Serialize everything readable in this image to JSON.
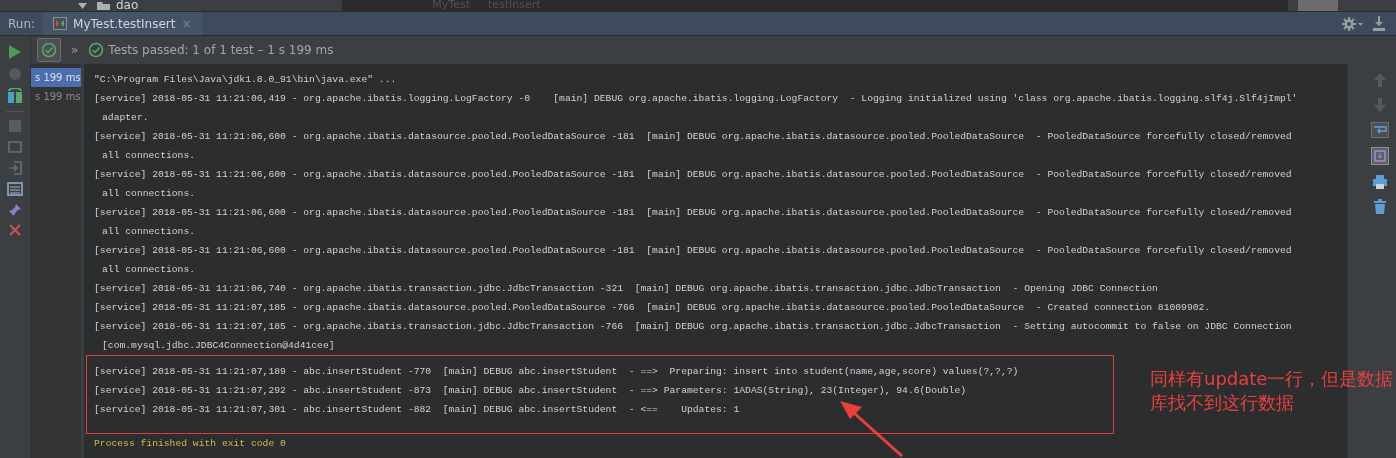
{
  "project_tree": {
    "folder": "dao",
    "breadcrumb": [
      "MyTest",
      "testInsert"
    ]
  },
  "run_bar": {
    "label": "Run:",
    "tab": {
      "title": "MyTest.testInsert",
      "close": "×"
    }
  },
  "test_toolbar": {
    "more": "»",
    "status": "Tests passed: 1 of 1 test – 1 s 199 ms"
  },
  "test_tree": [
    {
      "time": "s 199 ms",
      "selected": true
    },
    {
      "time": "s 199 ms",
      "selected": false
    }
  ],
  "console": [
    {
      "kind": "cmd",
      "text": "\"C:\\Program Files\\Java\\jdk1.8.0_91\\bin\\java.exe\" ..."
    },
    {
      "kind": "log",
      "text": "[service] 2018-05-31 11:21:06,419 - org.apache.ibatis.logging.LogFactory -0    [main] DEBUG org.apache.ibatis.logging.LogFactory  - Logging initialized using 'class org.apache.ibatis.logging.slf4j.Slf4jImpl'"
    },
    {
      "kind": "wrap",
      "text": "adapter."
    },
    {
      "kind": "log",
      "text": "[service] 2018-05-31 11:21:06,600 - org.apache.ibatis.datasource.pooled.PooledDataSource -181  [main] DEBUG org.apache.ibatis.datasource.pooled.PooledDataSource  - PooledDataSource forcefully closed/removed"
    },
    {
      "kind": "wrap",
      "text": "all connections."
    },
    {
      "kind": "log",
      "text": "[service] 2018-05-31 11:21:06,600 - org.apache.ibatis.datasource.pooled.PooledDataSource -181  [main] DEBUG org.apache.ibatis.datasource.pooled.PooledDataSource  - PooledDataSource forcefully closed/removed"
    },
    {
      "kind": "wrap",
      "text": "all connections."
    },
    {
      "kind": "log",
      "text": "[service] 2018-05-31 11:21:06,600 - org.apache.ibatis.datasource.pooled.PooledDataSource -181  [main] DEBUG org.apache.ibatis.datasource.pooled.PooledDataSource  - PooledDataSource forcefully closed/removed"
    },
    {
      "kind": "wrap",
      "text": "all connections."
    },
    {
      "kind": "log",
      "text": "[service] 2018-05-31 11:21:06,600 - org.apache.ibatis.datasource.pooled.PooledDataSource -181  [main] DEBUG org.apache.ibatis.datasource.pooled.PooledDataSource  - PooledDataSource forcefully closed/removed"
    },
    {
      "kind": "wrap",
      "text": "all connections."
    },
    {
      "kind": "log",
      "text": "[service] 2018-05-31 11:21:06,740 - org.apache.ibatis.transaction.jdbc.JdbcTransaction -321  [main] DEBUG org.apache.ibatis.transaction.jdbc.JdbcTransaction  - Opening JDBC Connection"
    },
    {
      "kind": "log",
      "text": "[service] 2018-05-31 11:21:07,185 - org.apache.ibatis.datasource.pooled.PooledDataSource -766  [main] DEBUG org.apache.ibatis.datasource.pooled.PooledDataSource  - Created connection 81009902."
    },
    {
      "kind": "log",
      "text": "[service] 2018-05-31 11:21:07,185 - org.apache.ibatis.transaction.jdbc.JdbcTransaction -766  [main] DEBUG org.apache.ibatis.transaction.jdbc.JdbcTransaction  - Setting autocommit to false on JDBC Connection"
    },
    {
      "kind": "wrap",
      "text": "[com.mysql.jdbc.JDBC4Connection@4d41cee]"
    }
  ],
  "highlighted_lines": [
    {
      "text": "[service] 2018-05-31 11:21:07,189 - abc.insertStudent -770  [main] DEBUG abc.insertStudent  - ==>  Preparing: insert into student(name,age,score) values(?,?,?)"
    },
    {
      "text": "[service] 2018-05-31 11:21:07,292 - abc.insertStudent -873  [main] DEBUG abc.insertStudent  - ==> Parameters: 1ADAS(String), 23(Integer), 94.6(Double)"
    },
    {
      "text": "[service] 2018-05-31 11:21:07,301 - abc.insertStudent -882  [main] DEBUG abc.insertStudent  - <==    Updates: 1"
    }
  ],
  "exit_line": "Process finished with exit code 0",
  "annotation": "同样有update一行，但是数据库找不到这行数据"
}
